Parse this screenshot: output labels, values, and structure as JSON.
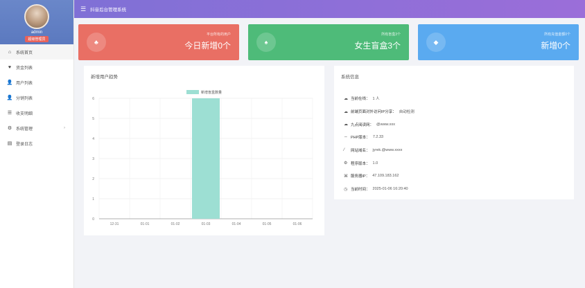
{
  "sidebar": {
    "username": "admin",
    "role": "超级管理员",
    "items": [
      {
        "icon": "home-icon",
        "glyph": "⌂",
        "label": "系统首页"
      },
      {
        "icon": "heart-icon",
        "glyph": "♥",
        "label": "资金列表"
      },
      {
        "icon": "user-icon",
        "glyph": "👤",
        "label": "用户列表"
      },
      {
        "icon": "person-icon",
        "glyph": "👤",
        "label": "分销列表"
      },
      {
        "icon": "database-icon",
        "glyph": "☰",
        "label": "收支明细"
      },
      {
        "icon": "settings-icon",
        "glyph": "⚙",
        "label": "系统管理"
      },
      {
        "icon": "document-icon",
        "glyph": "▤",
        "label": "登录日志"
      }
    ]
  },
  "topbar": {
    "title": "抖音后台管理系统"
  },
  "cards": [
    {
      "icon": "user-add-icon",
      "glyph": "♣",
      "sub": "平台所有的用户",
      "big": "今日新增0个"
    },
    {
      "icon": "users-icon",
      "glyph": "♠",
      "sub": "所有盲盒3个",
      "big": "女生盲盒3个"
    },
    {
      "icon": "diamond-icon",
      "glyph": "◆",
      "sub": "所有充值金额0个",
      "big": "新增0个"
    }
  ],
  "chart_panel": {
    "title": "新增用户趋势"
  },
  "info_panel": {
    "title": "系统信息",
    "rows": [
      {
        "icon": "cloud-icon",
        "glyph": "☁",
        "key": "当前在线：",
        "value": "1 人"
      },
      {
        "icon": "cloud-icon",
        "glyph": "☁",
        "key": "前端页面对外访问IP分享：",
        "value": "自动检测"
      },
      {
        "icon": "cloud-icon",
        "glyph": "☁",
        "key": "九点阅读网：",
        "value": "@www.xxx"
      },
      {
        "icon": "code-icon",
        "glyph": "⇔",
        "key": "PHP版本：",
        "value": "7.2.33"
      },
      {
        "icon": "link-icon",
        "glyph": "⁄",
        "key": "网站域名：",
        "value": "jyrek.@www.xxxx"
      },
      {
        "icon": "gear-icon",
        "glyph": "⚙",
        "key": "程序版本：",
        "value": "1.0"
      },
      {
        "icon": "server-icon",
        "glyph": "⌘",
        "key": "服务器IP：",
        "value": "47.109.183.162"
      },
      {
        "icon": "clock-icon",
        "glyph": "◷",
        "key": "当前时间：",
        "value": "2025-01-06 16:20:40"
      }
    ]
  },
  "chart_data": {
    "type": "bar",
    "categories": [
      "12-31",
      "01-01",
      "01-02",
      "01-03",
      "01-04",
      "01-05",
      "01-06"
    ],
    "series": [
      {
        "name": "新增盲盒数量",
        "values": [
          0,
          0,
          0,
          6,
          0,
          0,
          0
        ],
        "color": "#9ddfd3"
      }
    ],
    "ylim": [
      0,
      6
    ],
    "yticks": [
      0,
      1,
      2,
      3,
      4,
      5,
      6
    ],
    "grid": true,
    "legend": "top-center"
  }
}
